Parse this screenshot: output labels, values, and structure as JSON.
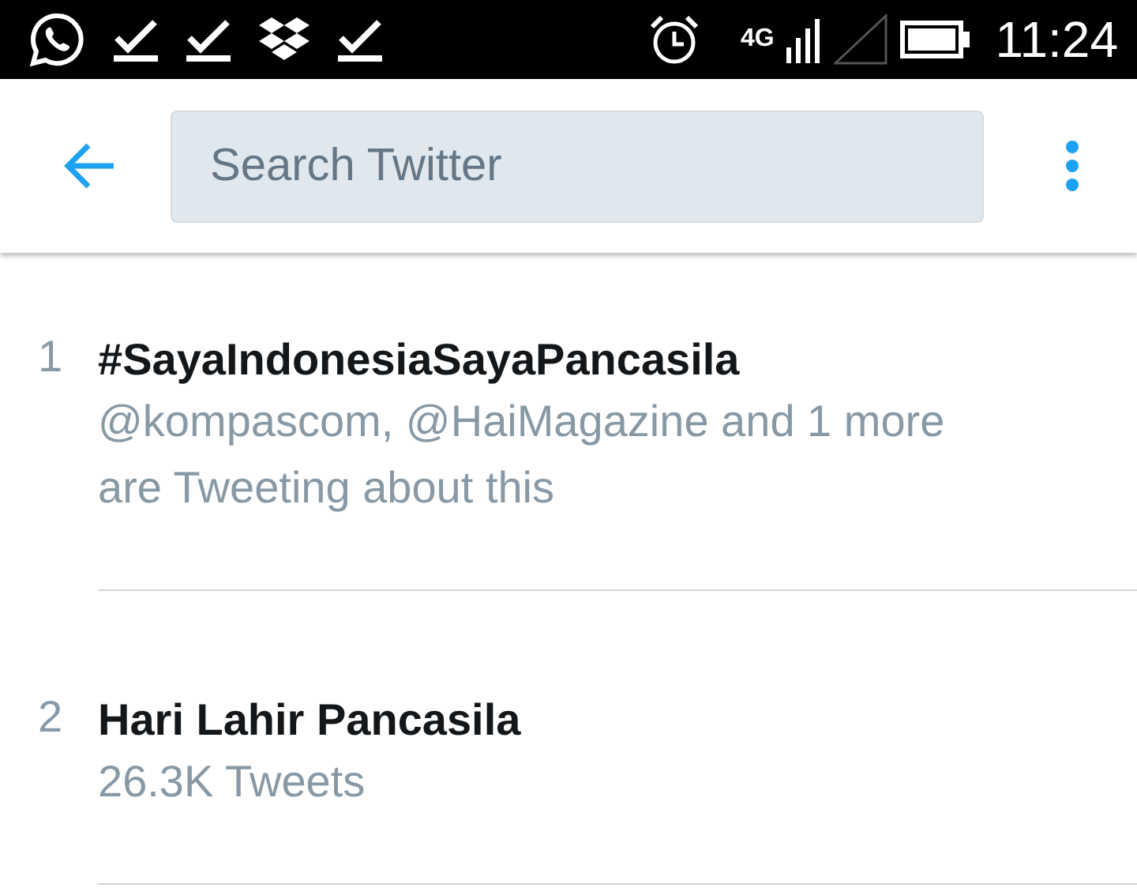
{
  "status_bar": {
    "network": "4G",
    "time": "11:24"
  },
  "toolbar": {
    "search": {
      "placeholder": "Search Twitter"
    }
  },
  "trends": [
    {
      "rank": "1",
      "name": "#SayaIndonesiaSayaPancasila",
      "context": "@kompascom, @HaiMagazine and 1 more are Tweeting about this"
    },
    {
      "rank": "2",
      "name": "Hari Lahir Pancasila",
      "context": "26.3K Tweets"
    }
  ]
}
